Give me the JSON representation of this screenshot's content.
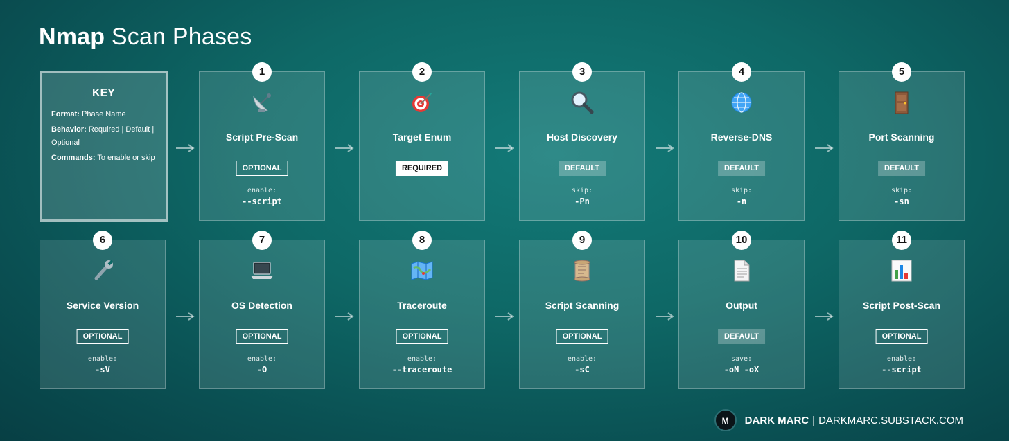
{
  "title": {
    "bold": "Nmap",
    "rest": "Scan Phases"
  },
  "key": {
    "heading": "KEY",
    "lines": [
      {
        "label": "Format:",
        "text": "Phase Name"
      },
      {
        "label": "Behavior:",
        "text": "Required | Default | Optional"
      },
      {
        "label": "Commands:",
        "text": "To enable or skip"
      }
    ]
  },
  "phases": [
    {
      "num": "1",
      "name": "Script Pre-Scan",
      "icon": "satellite-dish-icon",
      "badge": "OPTIONAL",
      "badge_type": "optional",
      "cmd_label": "enable:",
      "cmd": "--script"
    },
    {
      "num": "2",
      "name": "Target Enum",
      "icon": "target-icon",
      "badge": "REQUIRED",
      "badge_type": "required",
      "cmd_label": "",
      "cmd": ""
    },
    {
      "num": "3",
      "name": "Host Discovery",
      "icon": "magnifier-icon",
      "badge": "DEFAULT",
      "badge_type": "default",
      "cmd_label": "skip:",
      "cmd": "-Pn"
    },
    {
      "num": "4",
      "name": "Reverse-DNS",
      "icon": "globe-icon",
      "badge": "DEFAULT",
      "badge_type": "default",
      "cmd_label": "skip:",
      "cmd": "-n"
    },
    {
      "num": "5",
      "name": "Port Scanning",
      "icon": "door-icon",
      "badge": "DEFAULT",
      "badge_type": "default",
      "cmd_label": "skip:",
      "cmd": "-sn"
    },
    {
      "num": "6",
      "name": "Service Version",
      "icon": "wrench-icon",
      "badge": "OPTIONAL",
      "badge_type": "optional",
      "cmd_label": "enable:",
      "cmd": "-sV"
    },
    {
      "num": "7",
      "name": "OS Detection",
      "icon": "laptop-icon",
      "badge": "OPTIONAL",
      "badge_type": "optional",
      "cmd_label": "enable:",
      "cmd": "-O"
    },
    {
      "num": "8",
      "name": "Traceroute",
      "icon": "map-icon",
      "badge": "OPTIONAL",
      "badge_type": "optional",
      "cmd_label": "enable:",
      "cmd": "--traceroute"
    },
    {
      "num": "9",
      "name": "Script Scanning",
      "icon": "scroll-icon",
      "badge": "OPTIONAL",
      "badge_type": "optional",
      "cmd_label": "enable:",
      "cmd": "-sC"
    },
    {
      "num": "10",
      "name": "Output",
      "icon": "document-icon",
      "badge": "DEFAULT",
      "badge_type": "default",
      "cmd_label": "save:",
      "cmd": "-oN -oX"
    },
    {
      "num": "11",
      "name": "Script Post-Scan",
      "icon": "bar-chart-icon",
      "badge": "OPTIONAL",
      "badge_type": "optional",
      "cmd_label": "enable:",
      "cmd": "--script"
    }
  ],
  "footer": {
    "avatar": "M",
    "brand": "DARK MARC",
    "separator": "|",
    "url": "DARKMARC.SUBSTACK.COM"
  }
}
